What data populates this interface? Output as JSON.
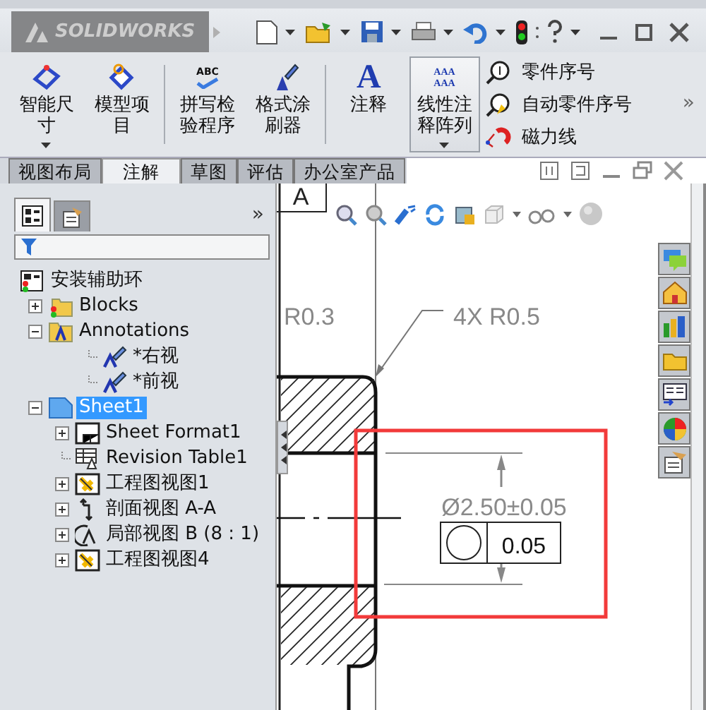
{
  "app": {
    "logo": "SOLIDWORKS"
  },
  "ribbon": {
    "large_buttons": [
      {
        "label": "智能尺寸",
        "kind": "smart-dimension",
        "pressed": false,
        "has_menu": true
      },
      {
        "label": "模型项目",
        "kind": "model-items",
        "pressed": false,
        "has_menu": false
      },
      {
        "label": "拼写检验程序",
        "kind": "spell-check",
        "icon_text": "ABC",
        "pressed": false,
        "has_menu": false,
        "separator_before": true
      },
      {
        "label": "格式涂刷器",
        "kind": "format-painter",
        "pressed": false,
        "has_menu": false
      },
      {
        "label": "注释",
        "kind": "note",
        "icon_text": "A",
        "pressed": false,
        "has_menu": false,
        "separator_before": true
      },
      {
        "label": "线性注释阵列",
        "kind": "note-pattern",
        "icon_text": "AAA AAA",
        "pressed": true,
        "has_menu": true
      }
    ],
    "small_buttons": [
      {
        "label": "零件序号",
        "kind": "balloon"
      },
      {
        "label": "自动零件序号",
        "kind": "auto-balloon"
      },
      {
        "label": "磁力线",
        "kind": "magnet"
      }
    ],
    "more": "»"
  },
  "tabs": [
    {
      "label": "视图布局",
      "selected": false
    },
    {
      "label": "注解",
      "selected": true
    },
    {
      "label": "草图",
      "selected": false
    },
    {
      "label": "评估",
      "selected": false
    },
    {
      "label": "办公室产品",
      "selected": false
    }
  ],
  "panel": {
    "tabs": [
      {
        "kind": "feature-tree",
        "selected": true
      },
      {
        "kind": "property",
        "selected": false
      }
    ],
    "more": "»"
  },
  "tree": {
    "items": [
      {
        "label": "安装辅助环",
        "kind": "drawing",
        "selected": false,
        "children": [
          {
            "label": "Blocks",
            "kind": "blocks",
            "selected": false,
            "expanded": false
          },
          {
            "label": "Annotations",
            "kind": "annotations",
            "selected": false,
            "expanded": true,
            "children": [
              {
                "label": "*右视",
                "kind": "annotation-view",
                "selected": false
              },
              {
                "label": "*前视",
                "kind": "annotation-view",
                "selected": false
              }
            ]
          },
          {
            "label": "Sheet1",
            "kind": "sheet",
            "selected": true,
            "expanded": true,
            "children": [
              {
                "label": "Sheet Format1",
                "kind": "sheet-format",
                "selected": false,
                "expanded": false
              },
              {
                "label": "Revision Table1",
                "kind": "revision-table",
                "selected": false
              },
              {
                "label": "工程图视图1",
                "kind": "drawing-view",
                "selected": false,
                "expanded": false
              },
              {
                "label": "剖面视图 A-A",
                "kind": "section-view",
                "selected": false,
                "expanded": false
              },
              {
                "label": "局部视图 B (8 : 1)",
                "kind": "detail-view",
                "selected": false,
                "expanded": false
              },
              {
                "label": "工程图视图4",
                "kind": "drawing-view",
                "selected": false,
                "expanded": false
              }
            ]
          }
        ]
      }
    ]
  },
  "drawing": {
    "view_label": "A",
    "radius_note": "R0.3",
    "leader_note": "4X R0.5",
    "diameter_dimension": "Ø2.50±0.05",
    "tolerance_value": "0.05",
    "highlight": true
  }
}
